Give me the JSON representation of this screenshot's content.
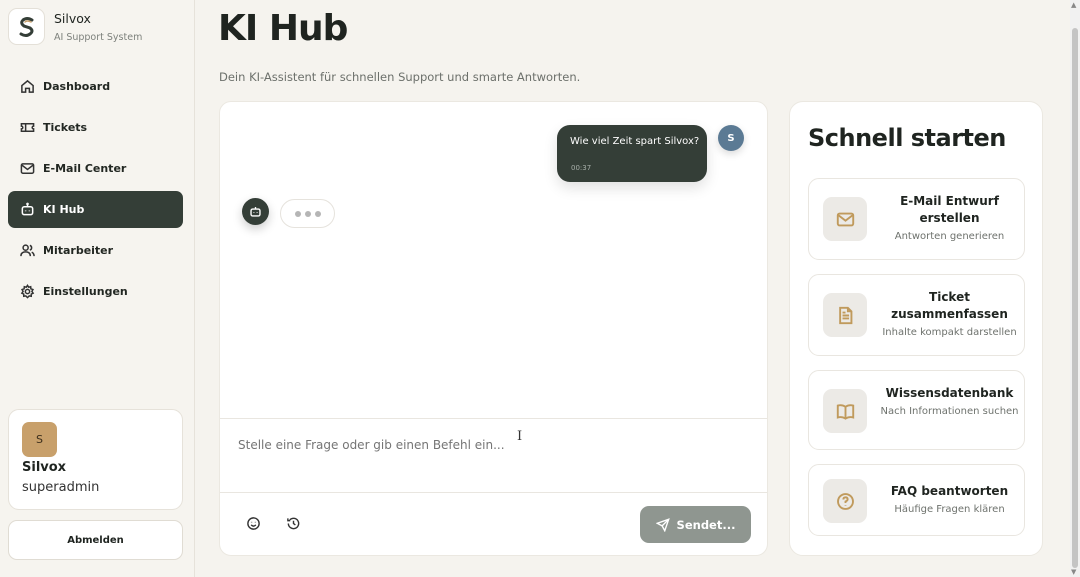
{
  "brand": {
    "name": "Silvox",
    "subtitle": "AI Support System"
  },
  "nav": [
    {
      "label": "Dashboard",
      "icon": "home-icon"
    },
    {
      "label": "Tickets",
      "icon": "ticket-icon"
    },
    {
      "label": "E-Mail Center",
      "icon": "mail-icon"
    },
    {
      "label": "KI Hub",
      "icon": "bot-icon",
      "active": true
    },
    {
      "label": "Mitarbeiter",
      "icon": "users-icon"
    },
    {
      "label": "Einstellungen",
      "icon": "gear-icon"
    }
  ],
  "user": {
    "initial": "S",
    "name": "Silvox",
    "role": "superadmin"
  },
  "logout_label": "Abmelden",
  "page": {
    "title": "KI Hub",
    "subtitle": "Dein KI-Assistent für schnellen Support und smarte Antworten."
  },
  "chat": {
    "user_message": "Wie viel Zeit spart Silvox?",
    "user_time": "00:37",
    "user_initial": "S",
    "input_placeholder": "Stelle eine Frage oder gib einen Befehl ein...",
    "send_label": "Sendet..."
  },
  "quick": {
    "title": "Schnell starten",
    "actions": [
      {
        "title": "E-Mail Entwurf erstellen",
        "subtitle": "Antworten generieren",
        "icon": "mail-icon"
      },
      {
        "title": "Ticket zusammenfassen",
        "subtitle": "Inhalte kompakt darstellen",
        "icon": "document-icon"
      },
      {
        "title": "Wissensdatenbank",
        "subtitle": "Nach Informationen suchen",
        "icon": "book-icon"
      },
      {
        "title": "FAQ beantworten",
        "subtitle": "Häufige Fragen klären",
        "icon": "help-circle-icon"
      }
    ]
  },
  "colors": {
    "accent_dark": "#343e37",
    "gold": "#c8a06b",
    "user_avatar": "#5b7a94",
    "send_button": "#8f9690"
  }
}
